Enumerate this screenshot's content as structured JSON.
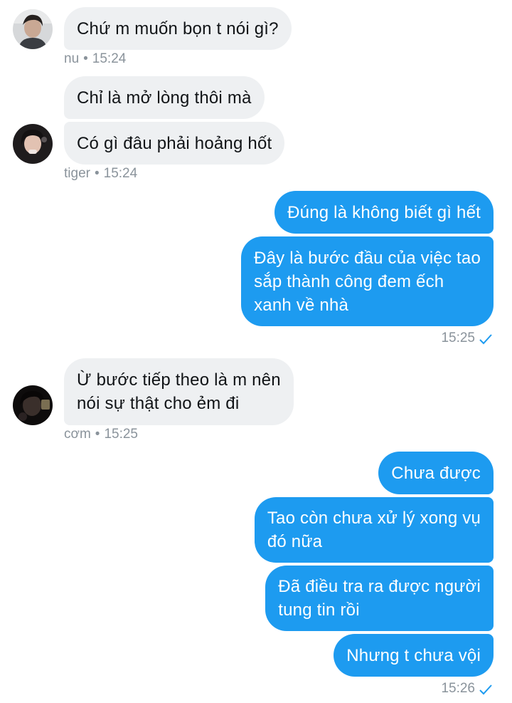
{
  "conversation": {
    "group1": {
      "sender": "nu",
      "time": "15:24",
      "messages": [
        "Chứ m muốn bọn t nói gì?"
      ]
    },
    "group2": {
      "sender": "tiger",
      "time": "15:24",
      "messages": [
        "Chỉ là mở lòng thôi mà",
        "Có gì đâu phải hoảng hốt"
      ]
    },
    "group3": {
      "time": "15:25",
      "messages": [
        [
          "Đúng là không biết gì hết"
        ],
        [
          "Đây là bước đầu của việc tao",
          "sắp thành công đem ếch",
          "xanh về nhà"
        ]
      ]
    },
    "group4": {
      "sender": "cơm",
      "time": "15:25",
      "messages": [
        [
          "Ừ bước tiếp theo là m nên",
          "nói sự thật cho ẻm đi"
        ]
      ]
    },
    "group5": {
      "time": "15:26",
      "messages": [
        [
          "Chưa được"
        ],
        [
          "Tao còn chưa xử lý xong vụ",
          "đó nữa"
        ],
        [
          "Đã điều tra ra được người",
          "tung tin rồi"
        ],
        [
          "Nhưng t chưa vội"
        ]
      ]
    }
  },
  "meta_separator": "•",
  "colors": {
    "outgoing_bubble": "#1d9bf0",
    "incoming_bubble": "#eef0f2",
    "meta_text": "#8a939b"
  },
  "icons": {
    "sent_status": "check-icon"
  }
}
